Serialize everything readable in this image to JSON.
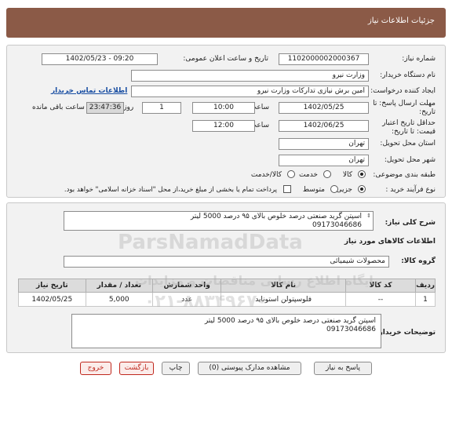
{
  "header": {
    "title": "جزئیات اطلاعات نیاز"
  },
  "fields": {
    "need_number_label": "شماره نیاز:",
    "need_number": "1102000002000367",
    "announce_label": "تاریخ و ساعت اعلان عمومی:",
    "announce_value": "1402/05/23 - 09:20",
    "buyer_org_label": "نام دستگاه خریدار:",
    "buyer_org": "وزارت نیرو",
    "creator_label": "ایجاد کننده درخواست:",
    "creator": "امین برش نیازی تدارکات وزارت نیرو",
    "contact_link": "اطلاعات تماس خریدار",
    "deadline_label": "مهلت ارسال پاسخ: تا تاریخ:",
    "deadline_date": "1402/05/25",
    "time_label": "ساعت",
    "deadline_time": "10:00",
    "days_value": "1",
    "days_label": "روز و",
    "remaining_time": "23:47:36",
    "remaining_label": "ساعت باقی مانده",
    "price_validity_label": "حداقل تاریخ اعتبار قیمت: تا تاریخ:",
    "validity_date": "1402/06/25",
    "validity_time_label": "ساعت",
    "validity_time": "12:00",
    "province_label": "استان محل تحویل:",
    "province": "تهران",
    "city_label": "شهر محل تحویل:",
    "city": "تهران",
    "category_label": "طبقه بندی موضوعی:",
    "category_options": [
      "کالا",
      "خدمت",
      "کالا/خدمت"
    ],
    "purchase_type_label": "نوع فرآیند خرید :",
    "purchase_options": [
      "جزیی",
      "متوسط"
    ],
    "payment_note": "پرداخت تمام یا بخشی از مبلغ خرید،از محل \"اسناد خزانه اسلامی\" خواهد بود."
  },
  "summary": {
    "label": "شرح کلی نیاز:",
    "line1": "اسپتن گرید صنعتی درصد خلوص بالای ۹۵ درصد 5000 لیتر",
    "line2": "09173046686"
  },
  "goods": {
    "section_title": "اطلاعات کالاهای مورد نیاز",
    "group_label": "گروه کالا:",
    "group_value": "محصولات شیمیائی",
    "columns": [
      "ردیف",
      "کد کالا",
      "نام کالا",
      "واحد شمارش",
      "تعداد / مقدار",
      "تاریخ نیاز"
    ],
    "rows": [
      {
        "row": "1",
        "code": "--",
        "name": "فلوسپتولن استونايد",
        "unit": "عدد",
        "qty": "5,000",
        "date": "1402/05/25"
      }
    ]
  },
  "buyer_notes": {
    "label": "توضیحات خریدار:",
    "line1": "اسپتن گرید صنعتی درصد خلوص بالای ۹۵ درصد 5000 لیتر",
    "line2": "09173046686"
  },
  "buttons": {
    "reply": "پاسخ به نیاز",
    "attachments": "مشاهده مدارک پیوستی (0)",
    "print": "چاپ",
    "back": "بازگشت",
    "exit": "خروج"
  },
  "watermark": {
    "brand": "ParsNamadData",
    "persian": "پایگاه اطلاع رسانی مناقصات و مزایدات",
    "phone": "۰۲۱-۸۸۳۴۹۶۷۰"
  },
  "colors": {
    "header": "#8b5a47",
    "panel": "#f2f2f2",
    "link": "#1a4fa3",
    "exit": "#c0281e"
  }
}
